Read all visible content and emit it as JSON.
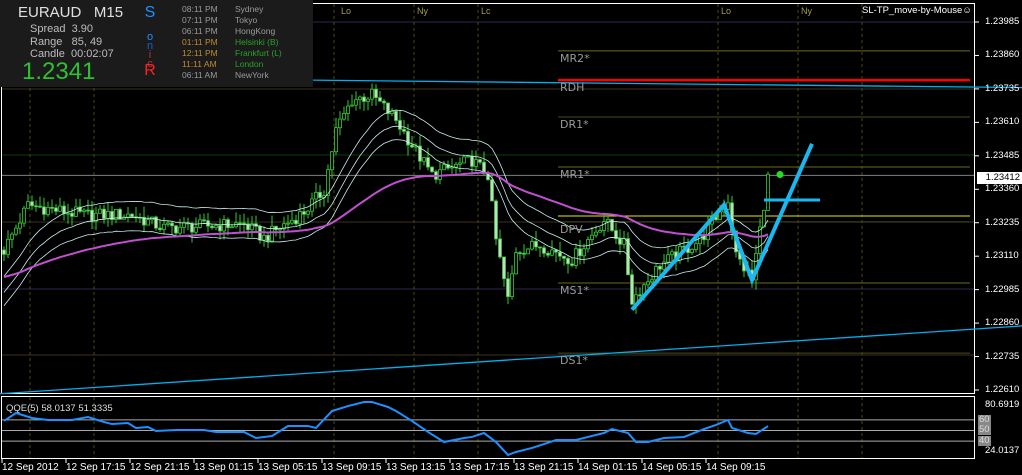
{
  "info_panel": {
    "symbol": "EURAUD",
    "timeframe": "M15",
    "spread_label": "Spread",
    "spread": "3.90",
    "range_label": "Range",
    "range": "85, 49",
    "candle_label": "Candle",
    "candle": "00:02:07",
    "price": "1.2341",
    "sonic_letters": [
      "S",
      "o",
      "n",
      "i",
      "c",
      "R"
    ],
    "sonic_colors": [
      "#1e90ff",
      "#1e90ff",
      "#1e5fd0",
      "#c03030",
      "#c03030",
      "#ff2020"
    ],
    "clocks": [
      {
        "time": "08:11 PM",
        "city": "Sydney",
        "color": "#9a9a9a",
        "city_color": "#9a9a9a"
      },
      {
        "time": "07:11 PM",
        "city": "Tokyo",
        "color": "#9a9a9a",
        "city_color": "#9a9a9a"
      },
      {
        "time": "06:11 PM",
        "city": "HongKong",
        "color": "#9a9a9a",
        "city_color": "#9a9a9a"
      },
      {
        "time": "01:11 PM",
        "city": "Helsinki  (B)",
        "color": "#c08a30",
        "city_color": "#2aa02a"
      },
      {
        "time": "12:11 PM",
        "city": "Frankfurt  (L)",
        "color": "#c08a30",
        "city_color": "#2aa02a"
      },
      {
        "time": "11:11 AM",
        "city": "London",
        "color": "#c08a30",
        "city_color": "#2aa02a"
      },
      {
        "time": "06:11 AM",
        "city": "NewYork",
        "color": "#9a9a9a",
        "city_color": "#9a9a9a"
      }
    ]
  },
  "ea_label": "SL-TP_move-by-Mouse☺",
  "sessions": [
    {
      "label": "Lo",
      "bar": 84
    },
    {
      "label": "Ny",
      "bar": 103
    },
    {
      "label": "Lc",
      "bar": 119
    },
    {
      "label": "Lo",
      "bar": 179
    },
    {
      "label": "Ny",
      "bar": 199
    }
  ],
  "colors": {
    "bull": "#32cd32",
    "bear_body": "#d0d0d0",
    "envelope": "#c8eef0",
    "slow_ma": "#c050d0",
    "trend": "#00b0f0",
    "drawing": "#1ab8f0",
    "rdh": "#ff0000",
    "dpv": "#e8e800",
    "qqe": "#1e90ff"
  },
  "chart_data": {
    "type": "candlestick",
    "symbol": "EURAUD",
    "timeframe": "M15",
    "ylim": [
      1.2256,
      1.2409
    ],
    "y_ticks": [
      "1.23985",
      "1.23860",
      "1.23735",
      "1.23610",
      "1.23485",
      "1.23360",
      "1.23235",
      "1.23110",
      "1.22985",
      "1.22860",
      "1.22735",
      "1.22610"
    ],
    "current_price": "1.23412",
    "bars": 192,
    "close_path": [
      [
        0,
        1.23133
      ],
      [
        6,
        1.23301
      ],
      [
        20,
        1.23264
      ],
      [
        32,
        1.23264
      ],
      [
        40,
        1.23215
      ],
      [
        60,
        1.2323
      ],
      [
        65,
        1.23178
      ],
      [
        75,
        1.23275
      ],
      [
        80,
        1.23357
      ],
      [
        83,
        1.23581
      ],
      [
        87,
        1.23693
      ],
      [
        92,
        1.23712
      ],
      [
        98,
        1.23619
      ],
      [
        102,
        1.23525
      ],
      [
        107,
        1.23413
      ],
      [
        117,
        1.23469
      ],
      [
        121,
        1.23413
      ],
      [
        123,
        1.2317
      ],
      [
        126,
        1.22946
      ],
      [
        128,
        1.23133
      ],
      [
        134,
        1.23152
      ],
      [
        142,
        1.23096
      ],
      [
        150,
        1.23245
      ],
      [
        155,
        1.23152
      ],
      [
        157,
        1.22946
      ],
      [
        164,
        1.23077
      ],
      [
        174,
        1.2317
      ],
      [
        181,
        1.2332
      ],
      [
        183,
        1.23114
      ],
      [
        187,
        1.23021
      ],
      [
        189,
        1.23208
      ],
      [
        191,
        1.23402
      ]
    ],
    "x_tick_labels": [
      {
        "bar": 0,
        "label": "12 Sep 2012"
      },
      {
        "bar": 16,
        "label": "12 Sep 17:15"
      },
      {
        "bar": 32,
        "label": "12 Sep 21:15"
      },
      {
        "bar": 48,
        "label": "13 Sep 01:15"
      },
      {
        "bar": 64,
        "label": "13 Sep 05:15"
      },
      {
        "bar": 80,
        "label": "13 Sep 09:15"
      },
      {
        "bar": 96,
        "label": "13 Sep 13:15"
      },
      {
        "bar": 112,
        "label": "13 Sep 17:15"
      },
      {
        "bar": 128,
        "label": "13 Sep 21:15"
      },
      {
        "bar": 144,
        "label": "14 Sep 01:15"
      },
      {
        "bar": 160,
        "label": "14 Sep 05:15"
      },
      {
        "bar": 176,
        "label": "14 Sep 09:15"
      }
    ],
    "pivot_levels": [
      {
        "label": "MR2*",
        "price": 1.23877,
        "color": "#6a6a20"
      },
      {
        "label": "RDH",
        "price": 1.23768,
        "color": "#ff0000"
      },
      {
        "label": "DR1*",
        "price": 1.2363,
        "color": "#4a4a20"
      },
      {
        "label": "MR1*",
        "price": 1.23443,
        "color": "#6a6a20"
      },
      {
        "label": "DPV",
        "price": 1.23238,
        "color": "#4a4a20"
      },
      {
        "label": "MS1*",
        "price": 1.2301,
        "color": "#6a6a20"
      },
      {
        "label": "DS1*",
        "price": 1.22748,
        "color": "#4a4a20"
      }
    ],
    "dpv_yellow_price": 1.2326,
    "trendlines": [
      {
        "from": [
          -1,
          1.2378
        ],
        "to": [
          255,
          1.2374
        ]
      },
      {
        "from": [
          -1,
          1.22596
        ],
        "to": [
          255,
          1.2285
        ]
      }
    ],
    "drawing": {
      "zigzag": [
        [
          157,
          1.2291
        ],
        [
          180,
          1.23302
        ],
        [
          187,
          1.23021
        ],
        [
          202,
          1.2353
        ]
      ],
      "hline": {
        "from": 190,
        "to": 204,
        "price": 1.2332
      }
    },
    "signal_dot": {
      "bar": 194,
      "price": 1.23415
    },
    "qqe": {
      "label": "QQE(5) 58.0137 51.3335",
      "ylim": [
        24.0137,
        80.6919
      ],
      "max_label": "80.6919",
      "min_label": "24.0137",
      "levels": [
        60,
        50,
        40
      ],
      "points": [
        [
          0,
          59.0
        ],
        [
          3,
          66.5
        ],
        [
          7,
          61.8
        ],
        [
          11,
          59.9
        ],
        [
          17,
          59.9
        ],
        [
          21,
          62.7
        ],
        [
          25,
          58.0
        ],
        [
          27,
          56.1
        ],
        [
          31,
          57.1
        ],
        [
          33,
          52.4
        ],
        [
          36,
          53.3
        ],
        [
          38,
          49.5
        ],
        [
          43,
          50.5
        ],
        [
          50,
          50.5
        ],
        [
          53,
          48.6
        ],
        [
          60,
          48.6
        ],
        [
          63,
          42.9
        ],
        [
          67,
          44.8
        ],
        [
          71,
          54.2
        ],
        [
          76,
          54.2
        ],
        [
          78,
          52.4
        ],
        [
          82,
          68.4
        ],
        [
          86,
          73.1
        ],
        [
          90,
          76.9
        ],
        [
          92,
          76.9
        ],
        [
          96,
          72.2
        ],
        [
          98,
          68.4
        ],
        [
          102,
          59.0
        ],
        [
          106,
          48.6
        ],
        [
          110,
          39.1
        ],
        [
          115,
          42.9
        ],
        [
          117,
          43.9
        ],
        [
          120,
          47.6
        ],
        [
          123,
          39.1
        ],
        [
          126,
          26.9
        ],
        [
          128,
          29.7
        ],
        [
          132,
          33.5
        ],
        [
          135,
          37.2
        ],
        [
          138,
          41.0
        ],
        [
          143,
          41.0
        ],
        [
          146,
          43.9
        ],
        [
          150,
          47.6
        ],
        [
          152,
          51.4
        ],
        [
          156,
          47.6
        ],
        [
          158,
          39.1
        ],
        [
          161,
          39.1
        ],
        [
          165,
          42.9
        ],
        [
          170,
          43.9
        ],
        [
          175,
          51.4
        ],
        [
          178,
          55.2
        ],
        [
          181,
          59.9
        ],
        [
          182,
          52.4
        ],
        [
          186,
          47.6
        ],
        [
          188,
          46.7
        ],
        [
          191,
          54.2
        ]
      ]
    }
  }
}
